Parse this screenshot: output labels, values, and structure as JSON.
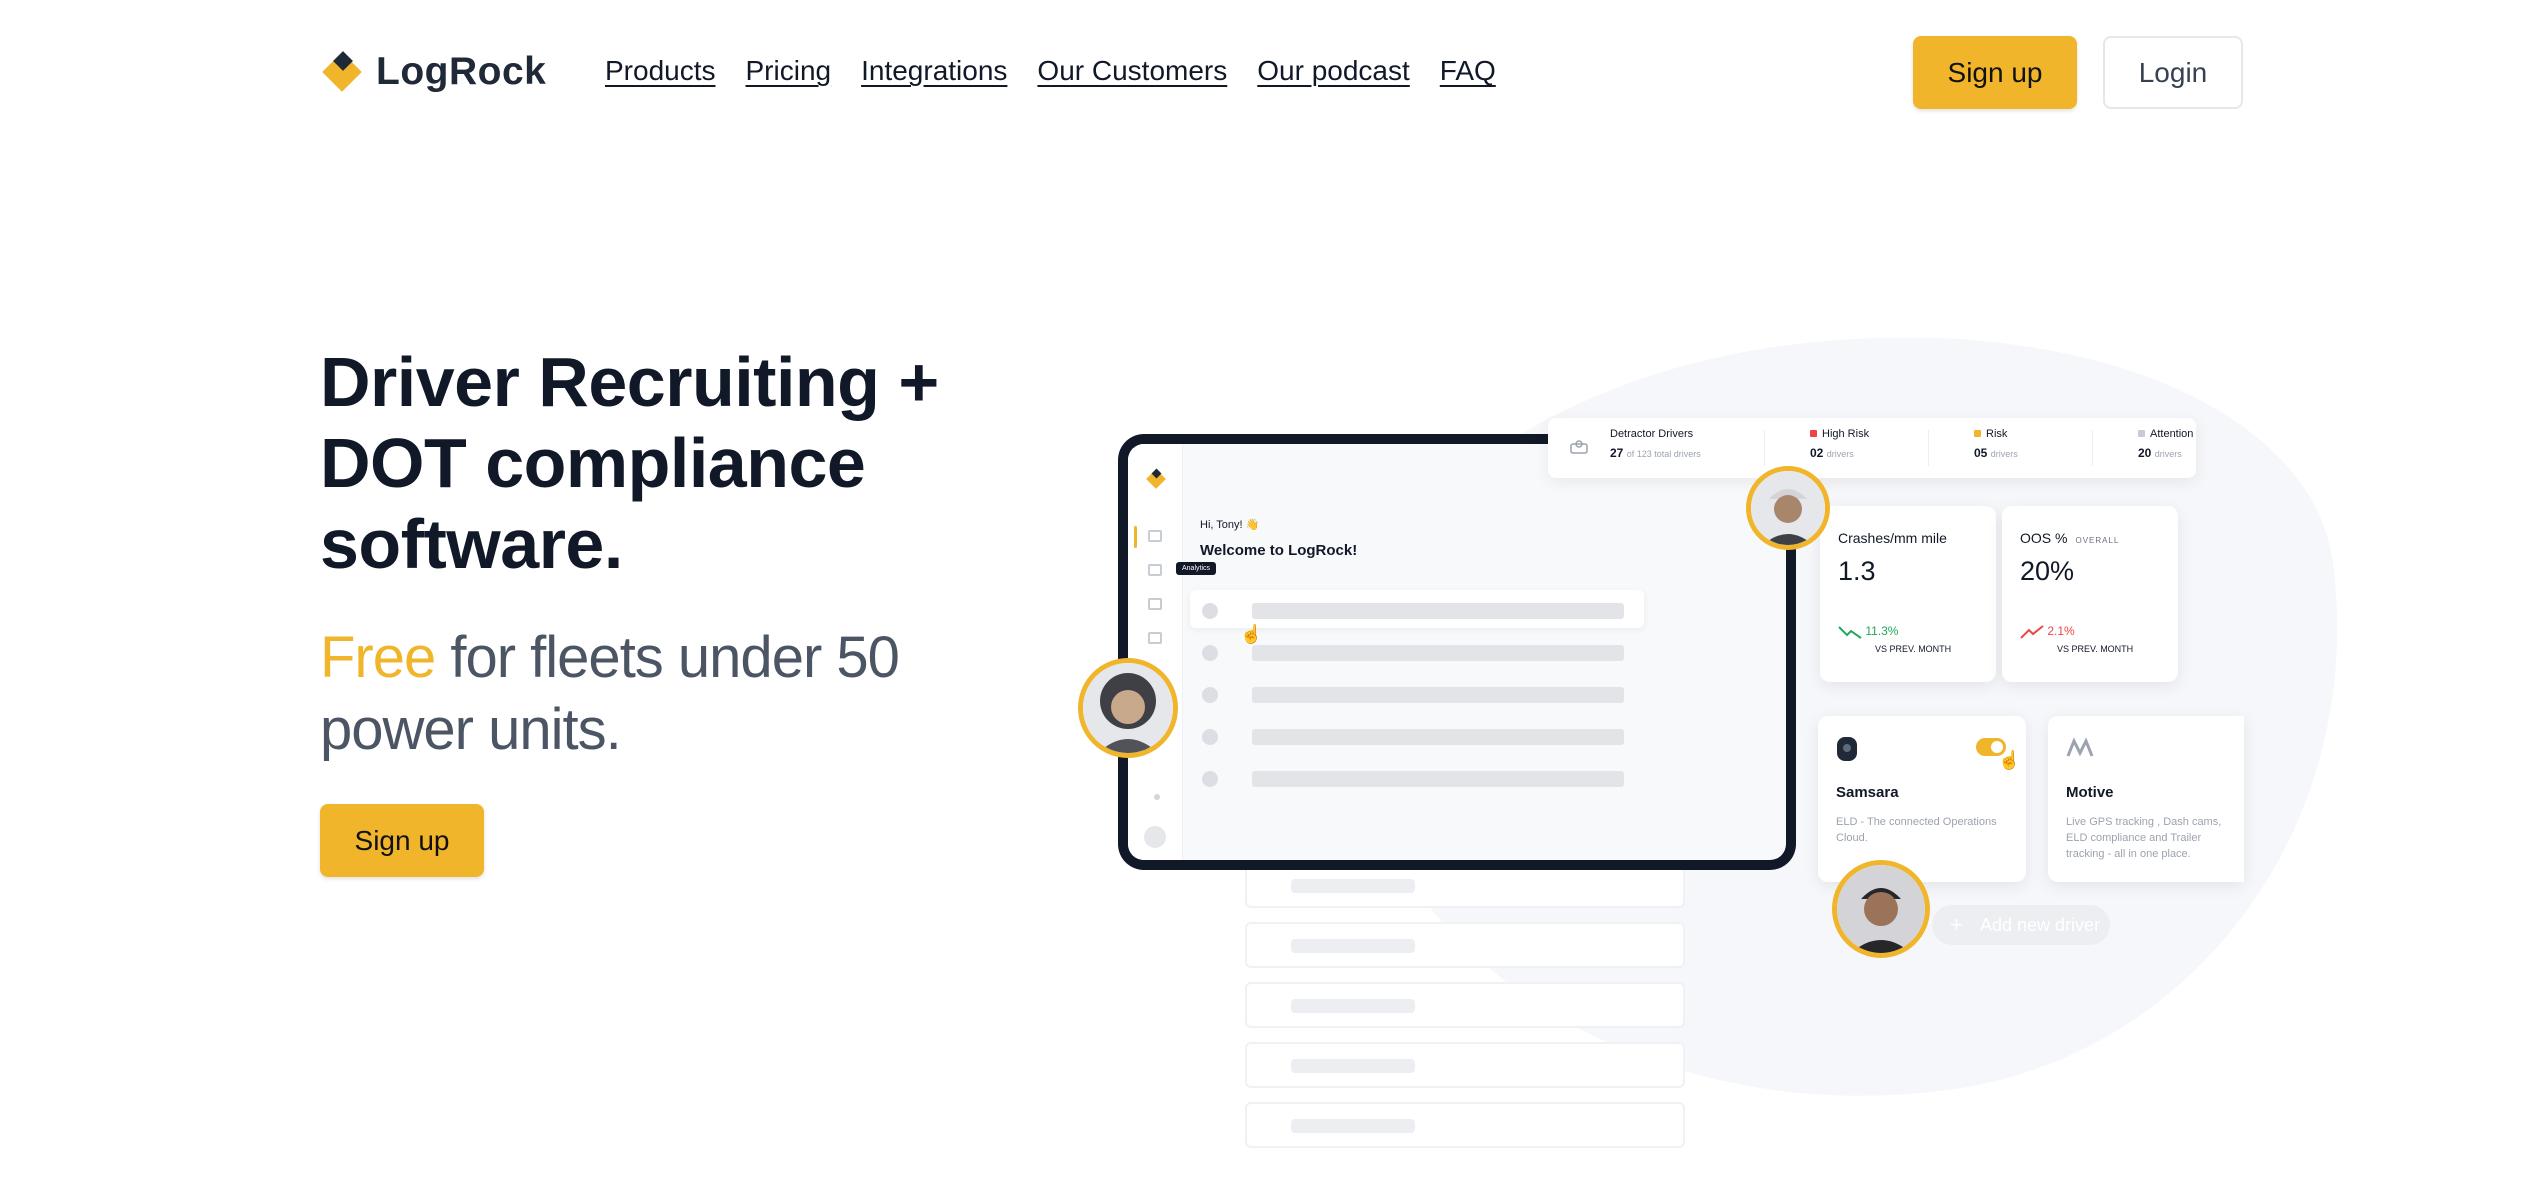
{
  "brand": {
    "name": "LogRock",
    "accent": "#f0b52b",
    "dark": "#111827"
  },
  "nav": {
    "links": [
      "Products",
      "Pricing",
      "Integrations",
      "Our Customers",
      "Our podcast",
      "FAQ"
    ],
    "signup_label": "Sign up",
    "login_label": "Login"
  },
  "hero": {
    "title": "Driver Recruiting + DOT compliance software.",
    "sub_highlight": "Free",
    "sub_rest": " for fleets under 50 power units.",
    "cta_label": "Sign up"
  },
  "app_preview": {
    "greeting": "Hi, Tony! 👋",
    "welcome": "Welcome to LogRock!",
    "tooltip": "Analytics",
    "stats": [
      {
        "label": "Detractor Drivers",
        "value": "27",
        "suffix": "of 123 total drivers",
        "color": ""
      },
      {
        "label": "High Risk",
        "value": "02",
        "suffix": "drivers",
        "color": "#ef4444"
      },
      {
        "label": "Risk",
        "value": "05",
        "suffix": "drivers",
        "color": "#f0b52b"
      },
      {
        "label": "Attention",
        "value": "20",
        "suffix": "drivers",
        "color": "#c7cbd6"
      }
    ],
    "cards": {
      "crashes": {
        "title": "Crashes/mm mile",
        "value": "1.3",
        "trend": "11.3%",
        "trend_dir": "down",
        "trend_color": "#22a85a",
        "vs": "VS PREV. MONTH"
      },
      "oos": {
        "title": "OOS %",
        "tag": "OVERALL",
        "value": "20%",
        "trend": "2.1%",
        "trend_dir": "up",
        "trend_color": "#ef4444",
        "vs": "VS PREV. MONTH"
      }
    },
    "integrations": [
      {
        "name": "Samsara",
        "desc": "ELD - The connected Operations Cloud.",
        "enabled": true
      },
      {
        "name": "Motive",
        "desc": "Live GPS tracking , Dash cams, ELD compliance and Trailer tracking - all in one place.",
        "enabled": false
      }
    ],
    "add_driver_label": "Add new driver"
  }
}
